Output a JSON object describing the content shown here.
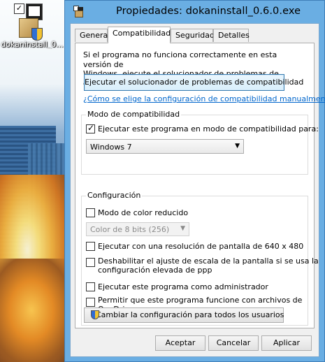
{
  "desktop": {
    "icon_label": "dokaninstall_0..."
  },
  "window": {
    "title": "Propiedades: dokaninstall_0.6.0.exe"
  },
  "tabs": [
    {
      "label": "General"
    },
    {
      "label": "Compatibilidad"
    },
    {
      "label": "Seguridad"
    },
    {
      "label": "Detalles"
    }
  ],
  "compat_tab": {
    "intro_line1": "Si el programa no funciona correctamente en esta versión de",
    "intro_line2": "Windows, ejecute el solucionador de problemas de compatibilidad.",
    "troubleshooter_button": "Ejecutar el solucionador de problemas de compatibilidad",
    "manual_link": "¿Cómo se elige la configuración de compatibilidad manualmente?",
    "compat_mode": {
      "legend": "Modo de compatibilidad",
      "checkbox_label": "Ejecutar este programa en modo de compatibilidad para:",
      "checked": true,
      "selected_os": "Windows 7"
    },
    "settings": {
      "legend": "Configuración",
      "reduced_color": {
        "label": "Modo de color reducido",
        "checked": false
      },
      "color_select": "Color de 8 bits (256)",
      "resolution": {
        "label": "Ejecutar con una resolución de pantalla de 640 x 480",
        "checked": false
      },
      "dpi": {
        "line1": "Deshabilitar el ajuste de escala de la pantalla si se usa la",
        "line2": "configuración elevada de ppp",
        "checked": false
      },
      "admin": {
        "label": "Ejecutar este programa como administrador",
        "checked": false
      },
      "onedrive": {
        "line1": "Permitir que este programa funcione con archivos de",
        "line2": "OneDrive",
        "checked": false
      }
    },
    "all_users_button": "Cambiar la configuración para todos los usuarios"
  },
  "buttons": {
    "ok": "Aceptar",
    "cancel": "Cancelar",
    "apply": "Aplicar"
  },
  "colors": {
    "title_bar": "#6aaee3",
    "link": "#0066cc",
    "dialog_bg": "#f0f0f0"
  }
}
